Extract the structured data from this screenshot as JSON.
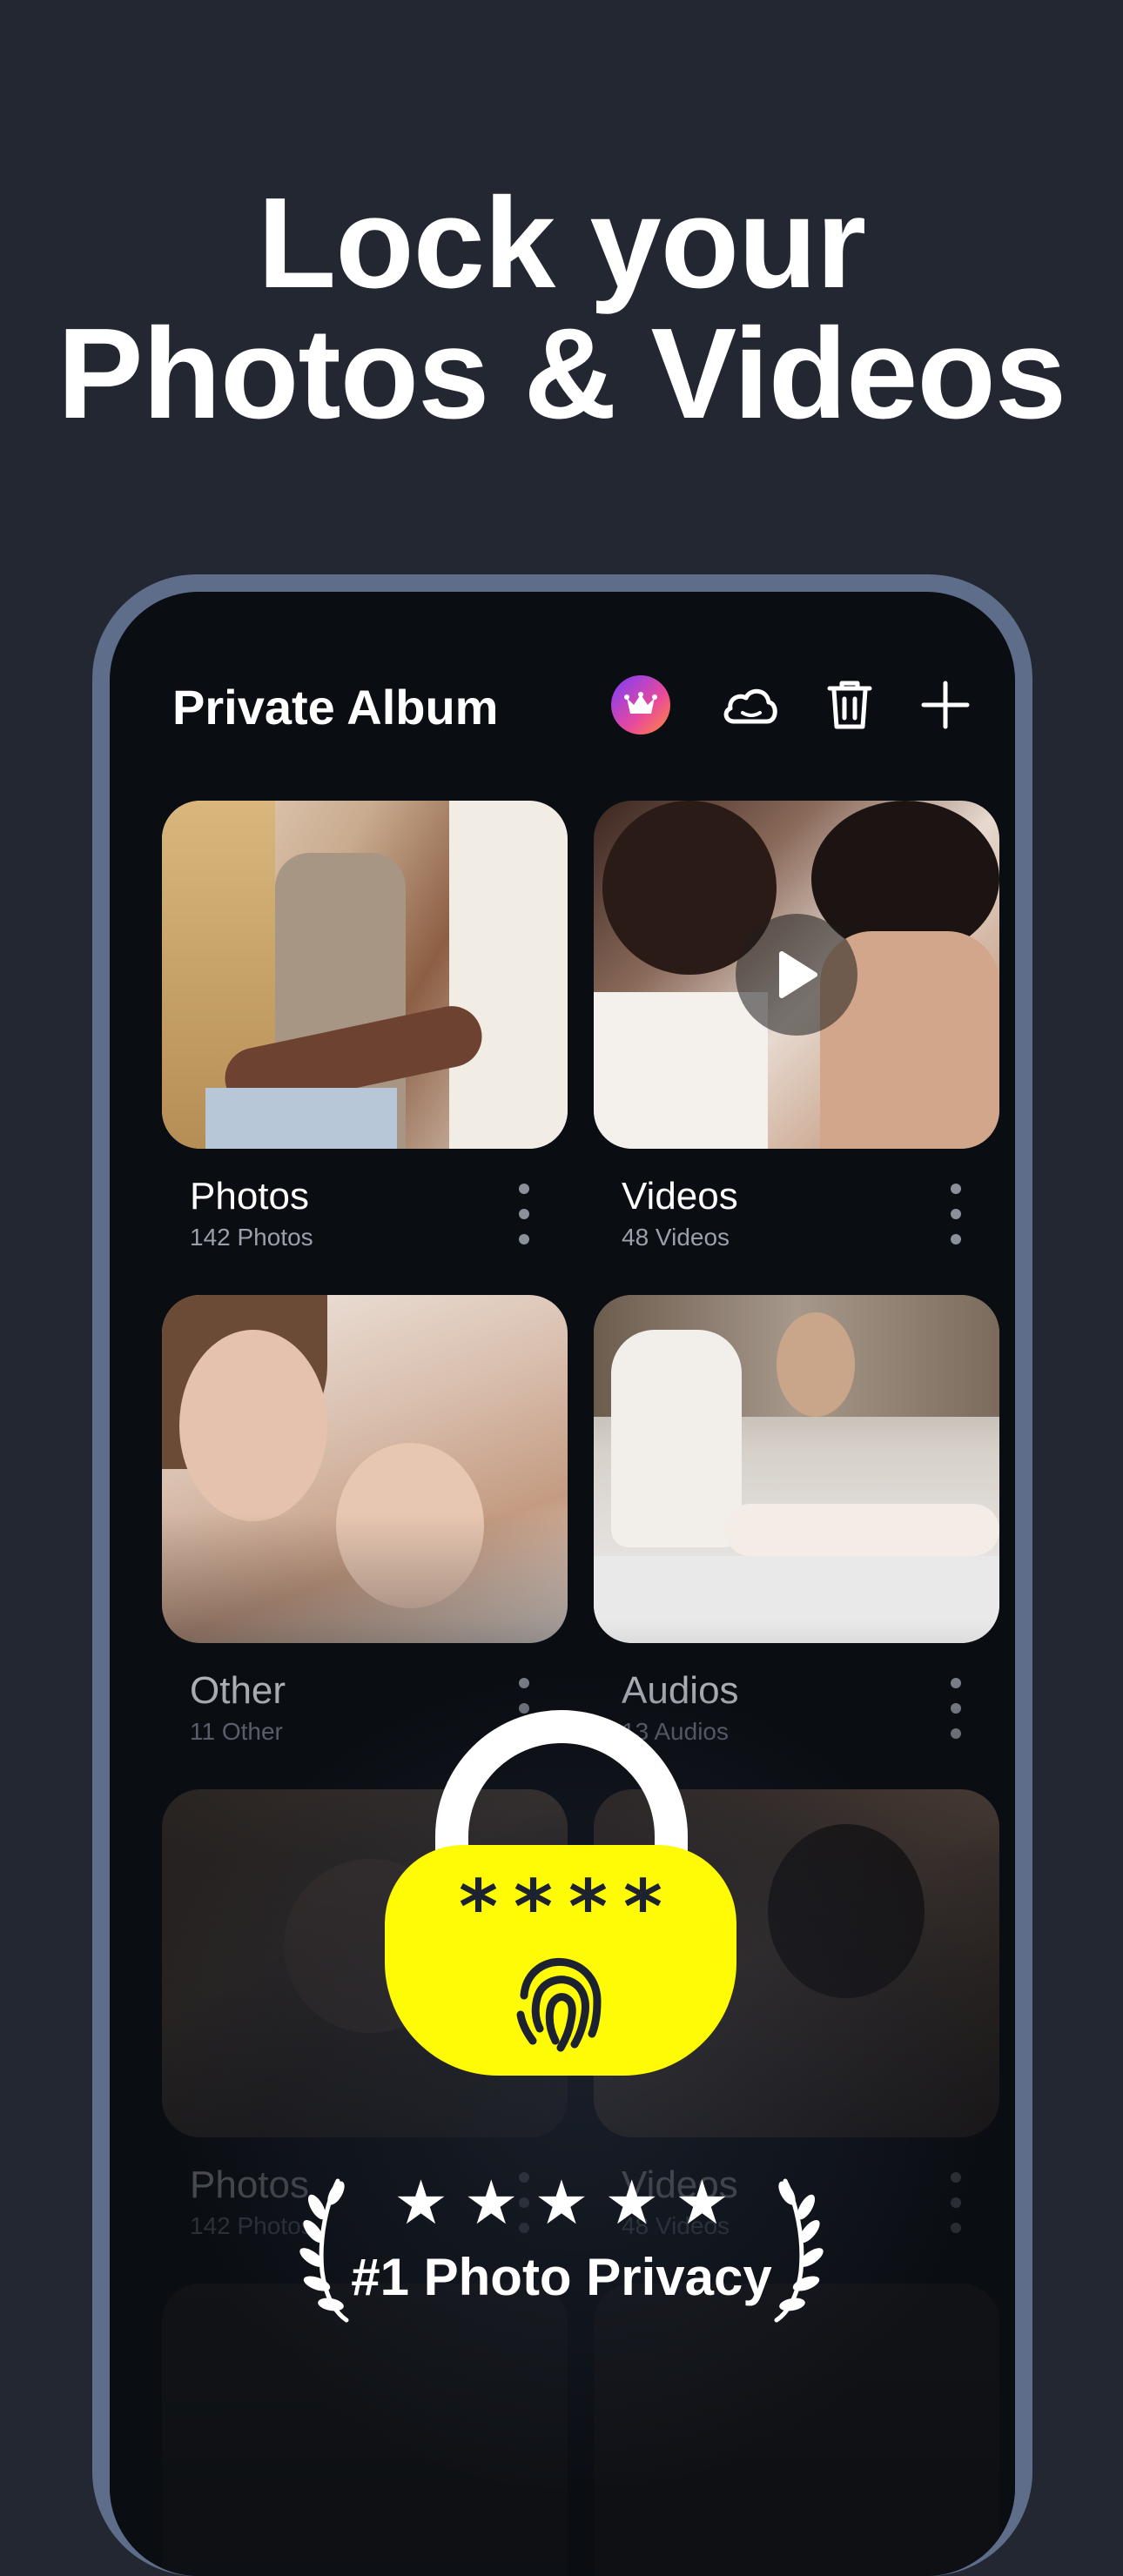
{
  "headline": {
    "line1": "Lock your",
    "line2": "Photos & Videos"
  },
  "app": {
    "title": "Private Album",
    "header_icons": [
      "crown-icon",
      "cloud-icon",
      "trash-icon",
      "plus-icon"
    ],
    "accent_gradient": [
      "#7a3cff",
      "#e84a9a",
      "#ff8a3c"
    ]
  },
  "albums": [
    {
      "title": "Photos",
      "count": "142 Photos"
    },
    {
      "title": "Videos",
      "count": "48 Videos"
    },
    {
      "title": "Other",
      "count": "11 Other"
    },
    {
      "title": "Audios",
      "count": "13 Audios"
    },
    {
      "title": "Photos",
      "count": "142 Photos"
    },
    {
      "title": "Videos",
      "count": "48 Videos"
    }
  ],
  "lock": {
    "pin_mask": "****",
    "color": "#fffb06"
  },
  "award": {
    "stars": "★★★★★",
    "rating": 5,
    "text": "#1 Photo Privacy"
  },
  "colors": {
    "background": "#222731",
    "phone_frame": "#5e6e8a",
    "screen": "#0a0d12"
  }
}
